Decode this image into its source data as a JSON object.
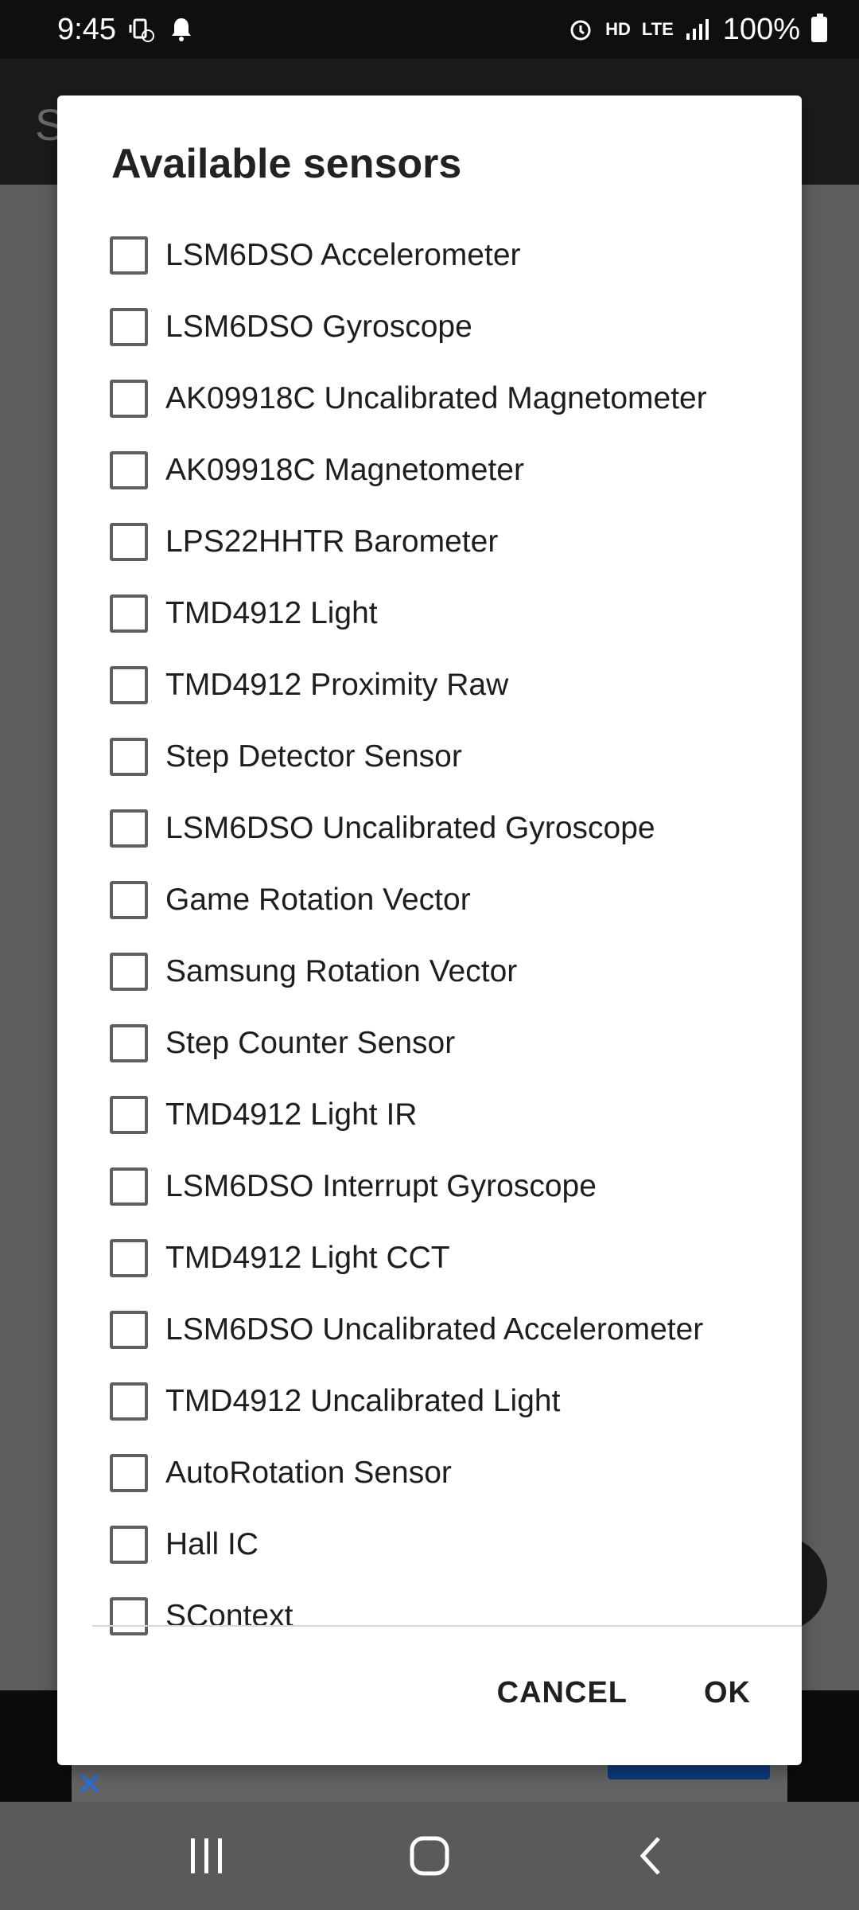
{
  "status_bar": {
    "time": "9:45",
    "battery_text": "100%",
    "network_text": "LTE",
    "hd_text": "HD"
  },
  "background_app": {
    "title_fragment": "S"
  },
  "dialog": {
    "title": "Available sensors",
    "sensors": [
      {
        "label": "LSM6DSO Accelerometer",
        "checked": false
      },
      {
        "label": "LSM6DSO Gyroscope",
        "checked": false
      },
      {
        "label": "AK09918C Uncalibrated Magnetometer",
        "checked": false
      },
      {
        "label": "AK09918C Magnetometer",
        "checked": false
      },
      {
        "label": "LPS22HHTR Barometer",
        "checked": false
      },
      {
        "label": "TMD4912 Light",
        "checked": false
      },
      {
        "label": "TMD4912 Proximity Raw",
        "checked": false
      },
      {
        "label": "Step Detector Sensor",
        "checked": false
      },
      {
        "label": "LSM6DSO Uncalibrated Gyroscope",
        "checked": false
      },
      {
        "label": "Game Rotation Vector",
        "checked": false
      },
      {
        "label": "Samsung Rotation Vector",
        "checked": false
      },
      {
        "label": "Step Counter Sensor",
        "checked": false
      },
      {
        "label": "TMD4912 Light IR",
        "checked": false
      },
      {
        "label": "LSM6DSO Interrupt Gyroscope",
        "checked": false
      },
      {
        "label": "TMD4912 Light CCT",
        "checked": false
      },
      {
        "label": "LSM6DSO Uncalibrated Accelerometer",
        "checked": false
      },
      {
        "label": "TMD4912 Uncalibrated Light",
        "checked": false
      },
      {
        "label": "AutoRotation Sensor",
        "checked": false
      },
      {
        "label": "Hall IC",
        "checked": false
      },
      {
        "label": "SContext",
        "checked": false
      }
    ],
    "cancel_label": "CANCEL",
    "ok_label": "OK"
  },
  "icons": {
    "status": [
      "vibrate-icon",
      "notification-bell-icon",
      "alarm-icon",
      "signal-icon",
      "battery-icon"
    ],
    "nav": [
      "recents-icon",
      "home-icon",
      "back-icon"
    ]
  },
  "colors": {
    "status_bar_bg": "#0f0f0f",
    "scrim": "#5d5d5d",
    "dialog_bg": "#ffffff",
    "checkbox_border": "#5f5f5f",
    "ad_close": "#2a6fe0"
  }
}
